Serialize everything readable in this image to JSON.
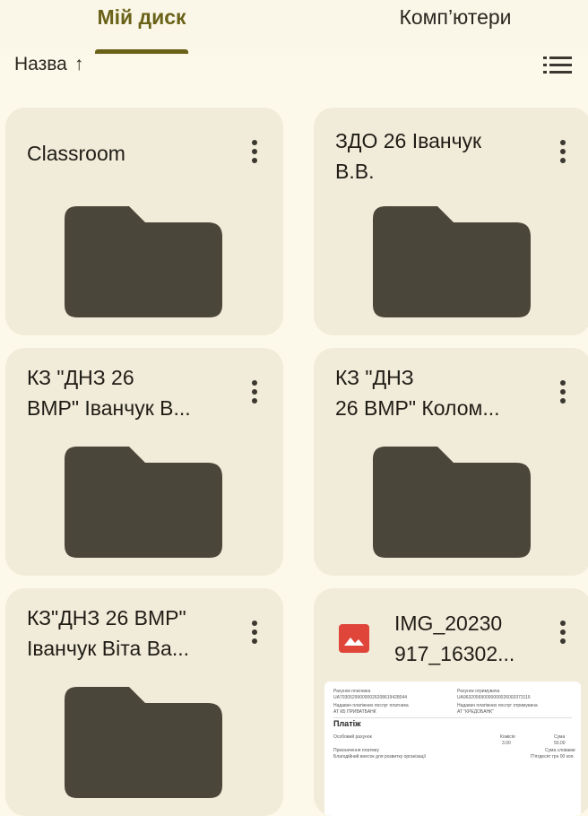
{
  "tabs": {
    "my_drive": "Мій диск",
    "computers": "Комп’ютери"
  },
  "sort": {
    "label": "Назва",
    "arrow": "↑"
  },
  "items": [
    {
      "title": "Classroom",
      "type": "folder-icon"
    },
    {
      "title": "ЗДО 26 Іванчук\nВ.В.",
      "type": "folder-icon"
    },
    {
      "title": "КЗ \"ДНЗ 26\nВМР\" Іванчук В...",
      "type": "folder-icon"
    },
    {
      "title": "КЗ \"ДНЗ\n26 ВМР\" Колом...",
      "type": "folder-icon"
    },
    {
      "title": "КЗ\"ДНЗ 26 ВМР\"\nІванчук Віта Ва...",
      "type": "folder-icon"
    },
    {
      "title": "IMG_20230\n917_16302...",
      "type": "image-icon"
    }
  ],
  "thumbnail": {
    "payer_account_label": "Рахунок платника",
    "payer_account": "UA703052990000026208619428044",
    "payer_bank_label": "Надавач платіжних послуг платника",
    "payer_bank": "АТ КБ ПРИВАТБАНК",
    "recipient_account_label": "Рахунок отримувача",
    "recipient_account": "UA963205690000000026003373116",
    "recipient_bank_label": "Надавач платіжних послуг отримувача",
    "recipient_bank": "АТ \"КРЕДОБАНК\"",
    "payment_title": "Платіж",
    "personal_account": "Особовий рахунок",
    "commission_label": "Комісія",
    "commission": "3.00",
    "sum_label": "Сума",
    "sum": "50.00",
    "purpose_label": "Призначення платежу",
    "purpose": "Благодійний внесок для розвитку організації",
    "sum_words_label": "Сума словами",
    "sum_words": "П'ятдесят грн 00 коп."
  },
  "colors": {
    "background": "#fdf9ea",
    "card": "#f1ebd9",
    "accent": "#6a6218",
    "folder": "#4a4639",
    "image_icon": "#e0453a"
  }
}
